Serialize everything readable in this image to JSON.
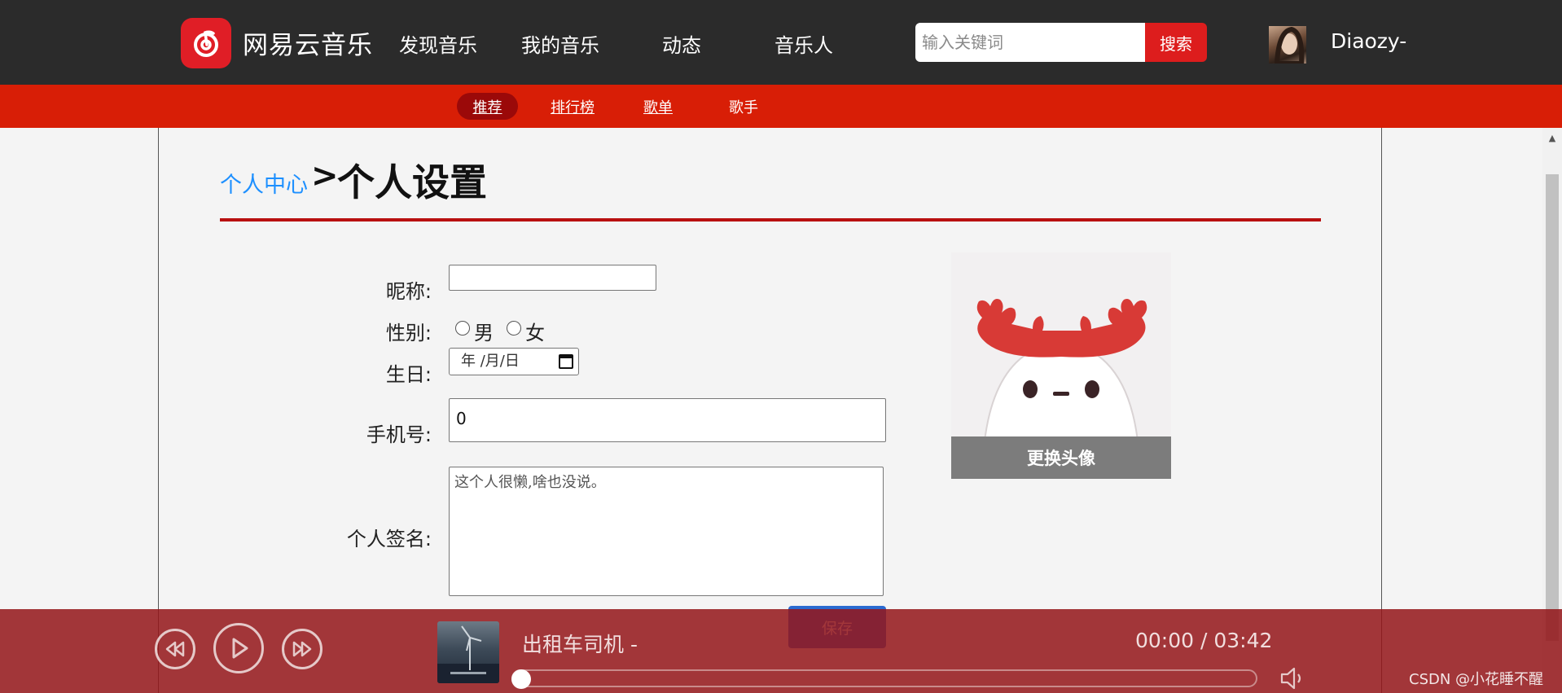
{
  "header": {
    "logo_text": "网易云音乐",
    "nav": [
      "发现音乐",
      "我的音乐",
      "动态",
      "音乐人"
    ],
    "search_placeholder": "输入关键词",
    "search_button": "搜索",
    "username": "Diaozy-"
  },
  "subnav": {
    "items": [
      "推荐",
      "排行榜",
      "歌单",
      "歌手"
    ],
    "active_index": 0
  },
  "breadcrumb": {
    "parent": "个人中心",
    "separator": ">",
    "current": "个人设置"
  },
  "form": {
    "nickname_label": "昵称:",
    "nickname_value": "",
    "gender_label": "性别:",
    "gender_options": [
      "男",
      "女"
    ],
    "birthday_label": "生日:",
    "birthday_placeholder": "年 /月/日",
    "phone_label": "手机号:",
    "phone_value": "0",
    "signature_label": "个人签名:",
    "signature_value": "这个人很懒,啥也没说。",
    "save_button": "保存",
    "change_avatar": "更换头像"
  },
  "player": {
    "song_title": "出租车司机 -",
    "time": "00:00 / 03:42",
    "progress": 0
  },
  "watermark": "CSDN @小花睡不醒",
  "colors": {
    "topbar": "#2b2b2b",
    "subbar": "#d81e06",
    "accent_red": "#b81010",
    "link_blue": "#1e90ff",
    "player_bg": "#94161a"
  }
}
